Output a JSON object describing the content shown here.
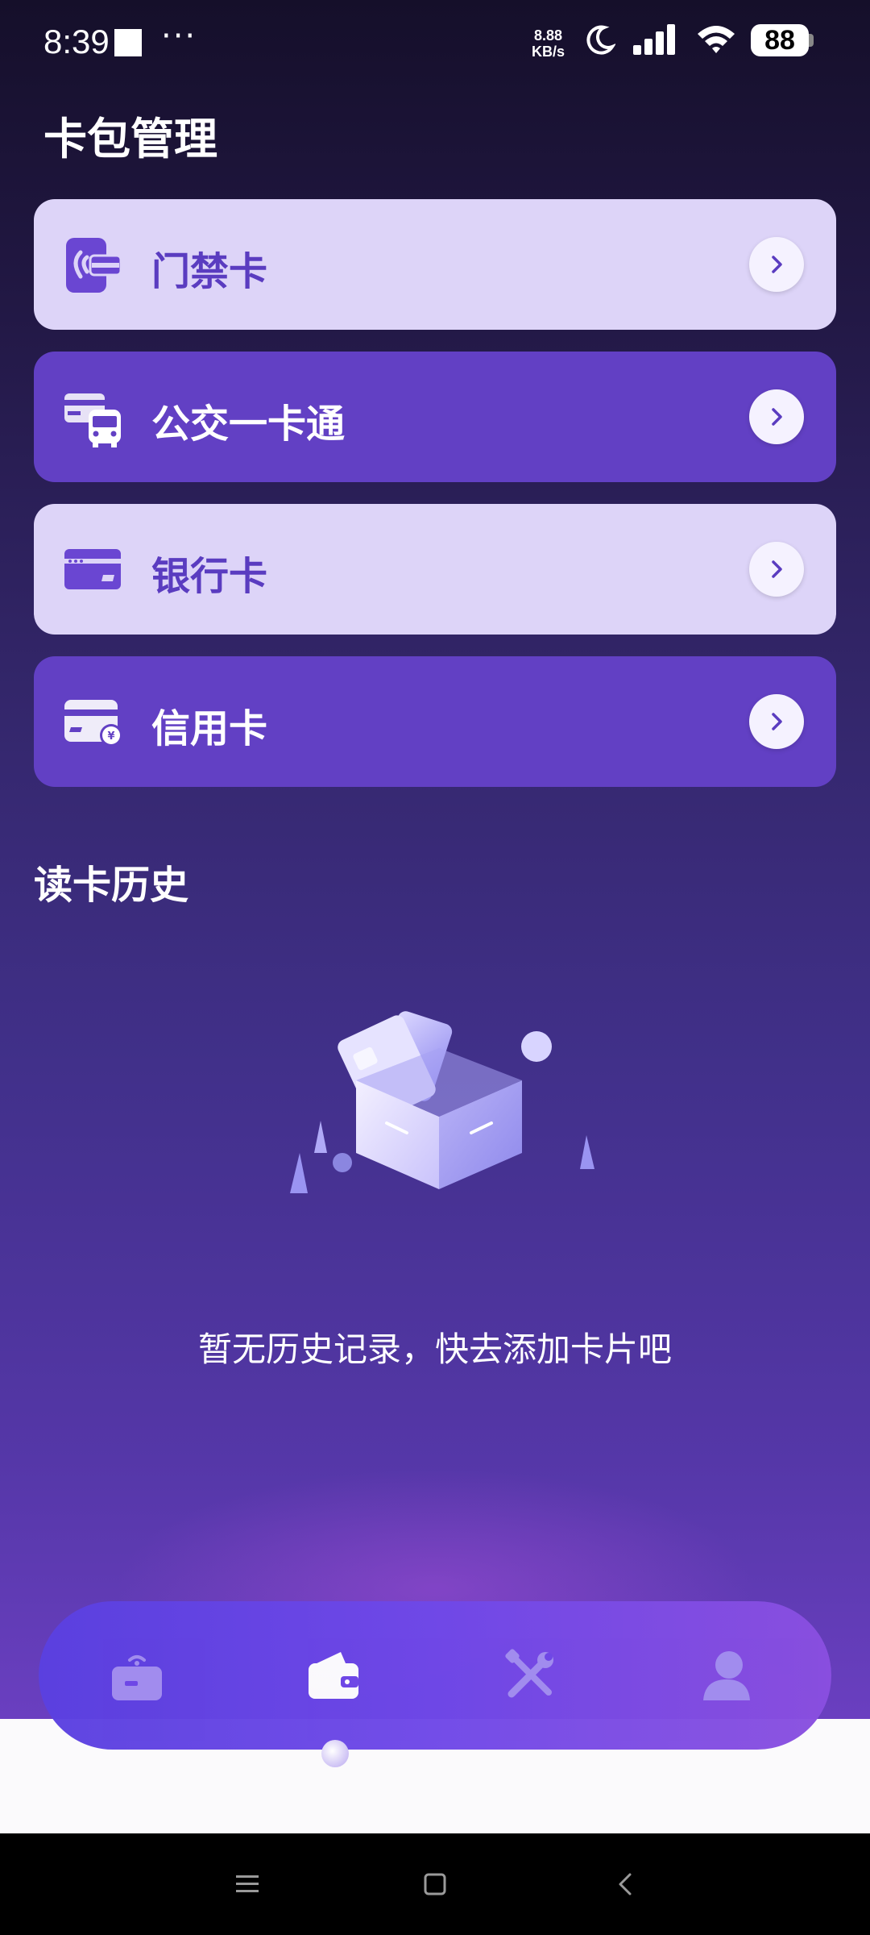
{
  "status_bar": {
    "time": "8:39",
    "more": "···",
    "net_speed_value": "8.88",
    "net_speed_unit": "KB/s",
    "battery": "88"
  },
  "header": {
    "title": "卡包管理"
  },
  "cards": [
    {
      "label": "门禁卡",
      "icon": "access-card-icon",
      "style": "light"
    },
    {
      "label": "公交一卡通",
      "icon": "bus-card-icon",
      "style": "dark"
    },
    {
      "label": "银行卡",
      "icon": "bank-card-icon",
      "style": "light"
    },
    {
      "label": "信用卡",
      "icon": "credit-card-icon",
      "style": "dark"
    }
  ],
  "history": {
    "title": "读卡历史",
    "empty_message": "暂无历史记录，快去添加卡片吧"
  },
  "tabbar": {
    "tabs": [
      {
        "icon": "reader-icon",
        "active": false
      },
      {
        "icon": "wallet-icon",
        "active": true
      },
      {
        "icon": "tools-icon",
        "active": false
      },
      {
        "icon": "profile-icon",
        "active": false
      }
    ]
  },
  "colors": {
    "accent": "#6240c4",
    "light_card": "#ddd4f8",
    "tabbar": "#6f48e8"
  }
}
